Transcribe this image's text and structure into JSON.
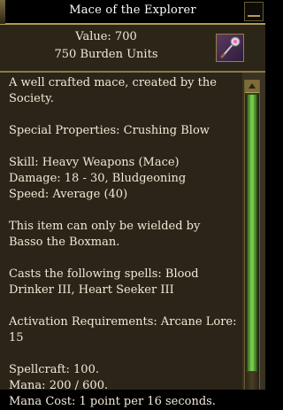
{
  "window": {
    "title": "Mace of the Explorer"
  },
  "item": {
    "value": "Value: 700",
    "burden": "750 Burden Units",
    "icon": "mace-icon"
  },
  "description": {
    "lines": [
      "A well crafted mace, created by the Society.",
      "Special Properties: Crushing Blow",
      "Skill: Heavy Weapons (Mace)",
      "Damage: 18 - 30, Bludgeoning",
      "Speed: Average (40)",
      "This item can only be wielded by Basso the Boxman.",
      "Casts the following spells: Blood Drinker III, Heart Seeker III",
      "Activation Requirements: Arcane Lore: 15",
      "Spellcraft: 100.",
      "Mana: 200 / 600.",
      "Mana Cost: 1 point per 16 seconds."
    ]
  },
  "colors": {
    "accent": "#b69a52",
    "scroll_thumb": "#6bbd3a",
    "panel": "#2b2418"
  }
}
